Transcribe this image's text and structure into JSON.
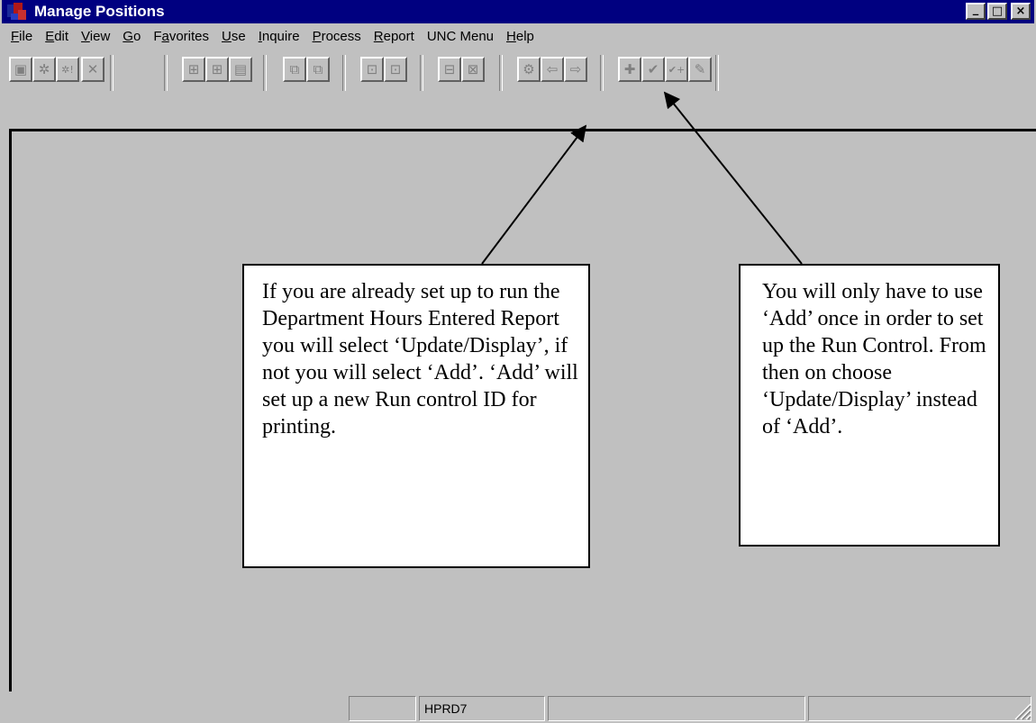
{
  "window": {
    "title": "Manage Positions",
    "controls": [
      "_",
      "□",
      "×"
    ]
  },
  "menu": [
    {
      "label": "File",
      "key": "F",
      "rest": "ile"
    },
    {
      "label": "Edit",
      "key": "E",
      "rest": "dit"
    },
    {
      "label": "View",
      "key": "V",
      "rest": "iew"
    },
    {
      "label": "Go",
      "key": "G",
      "rest": "o"
    },
    {
      "label": "Favorites",
      "prefix": "F",
      "key": "a",
      "rest": "vorites"
    },
    {
      "label": "Use",
      "key": "U",
      "rest": "se"
    },
    {
      "label": "Inquire",
      "key": "I",
      "rest": "nquire"
    },
    {
      "label": "Process",
      "key": "P",
      "rest": "rocess"
    },
    {
      "label": "Report",
      "key": "R",
      "rest": "eport"
    },
    {
      "label": "UNC Menu"
    },
    {
      "label": "Help",
      "key": "H",
      "rest": "elp"
    }
  ],
  "toolbar": {
    "buttons": [
      {
        "name": "save-icon",
        "glyph": "▣"
      },
      {
        "name": "gear-icon",
        "glyph": "✲"
      },
      {
        "name": "gear-alert-icon",
        "glyph": "✲!"
      },
      {
        "name": "delete-icon",
        "glyph": "✕"
      },
      {
        "name": "insert-row-icon",
        "glyph": "⊞"
      },
      {
        "name": "insert-row-2-icon",
        "glyph": "⊞"
      },
      {
        "name": "list-icon",
        "glyph": "▤"
      },
      {
        "name": "copy-icon",
        "glyph": "⧉"
      },
      {
        "name": "copy-2-icon",
        "glyph": "⧉"
      },
      {
        "name": "next-panel-icon",
        "glyph": "⊡"
      },
      {
        "name": "prev-panel-icon",
        "glyph": "⊡"
      },
      {
        "name": "add-row-icon",
        "glyph": "⊟"
      },
      {
        "name": "delete-row-icon",
        "glyph": "⊠"
      },
      {
        "name": "update-display-icon",
        "glyph": "⚙"
      },
      {
        "name": "arrow-left-icon",
        "glyph": "⇦"
      },
      {
        "name": "arrow-right-icon",
        "glyph": "⇨"
      },
      {
        "name": "add-icon",
        "glyph": "✚"
      },
      {
        "name": "check-icon",
        "glyph": "✔"
      },
      {
        "name": "check-plus-icon",
        "glyph": "✔+"
      },
      {
        "name": "edit-icon",
        "glyph": "✎"
      }
    ]
  },
  "statusbar": {
    "cells": [
      "",
      "HPRD7",
      "",
      ""
    ]
  },
  "callouts": {
    "left": "If you are already set up to run the Department Hours Entered Report you will select ‘Update/Display’, if not you will select ‘Add’. ‘Add’ will set up a new Run control ID for printing.",
    "right": "You will only have to use ‘Add’ once in order to set up the Run Control. From then on choose ‘Update/Display’ instead of ‘Add’."
  }
}
